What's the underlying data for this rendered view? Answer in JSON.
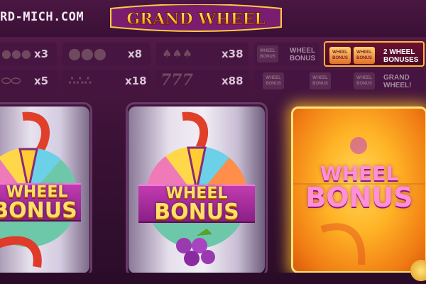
{
  "site": {
    "watermark": "RD-MICH.COM"
  },
  "logo": {
    "title": "GRAND WHEEL"
  },
  "paytable": {
    "row1": [
      {
        "symbols": "cherries",
        "multiplier": "x3"
      },
      {
        "symbols": "oranges",
        "multiplier": "x8"
      },
      {
        "symbols": "bells",
        "multiplier": "x38"
      },
      {
        "symbols": "wheel-bonus",
        "label": "WHEEL BONUS"
      },
      {
        "symbols": "two-wheel-bonus",
        "label": "2 WHEEL BONUSES",
        "highlighted": true
      }
    ],
    "row2": [
      {
        "symbols": "lemons",
        "multiplier": "x5"
      },
      {
        "symbols": "grapes",
        "multiplier": "x18"
      },
      {
        "symbols": "sevens",
        "text": "777",
        "multiplier": "x88"
      },
      {
        "symbols": "three-wheel-bonus",
        "label": "GRAND WHEEL!"
      }
    ],
    "mini_label_line1": "WHEEL",
    "mini_label_line2": "BONUS"
  },
  "reels": [
    {
      "symbol": "wheel-bonus",
      "line1": "WHEEL",
      "line2": "BONUS",
      "state": "idle"
    },
    {
      "symbol": "wheel-bonus",
      "line1": "WHEEL",
      "line2": "BONUS",
      "state": "idle"
    },
    {
      "symbol": "wheel-bonus",
      "line1": "WHEEL",
      "line2": "BONUS",
      "state": "spinning-highlighted"
    }
  ],
  "colors": {
    "accent": "#ffb43a",
    "bonus_text": "#ffe066",
    "banner": "#a52a9c"
  }
}
